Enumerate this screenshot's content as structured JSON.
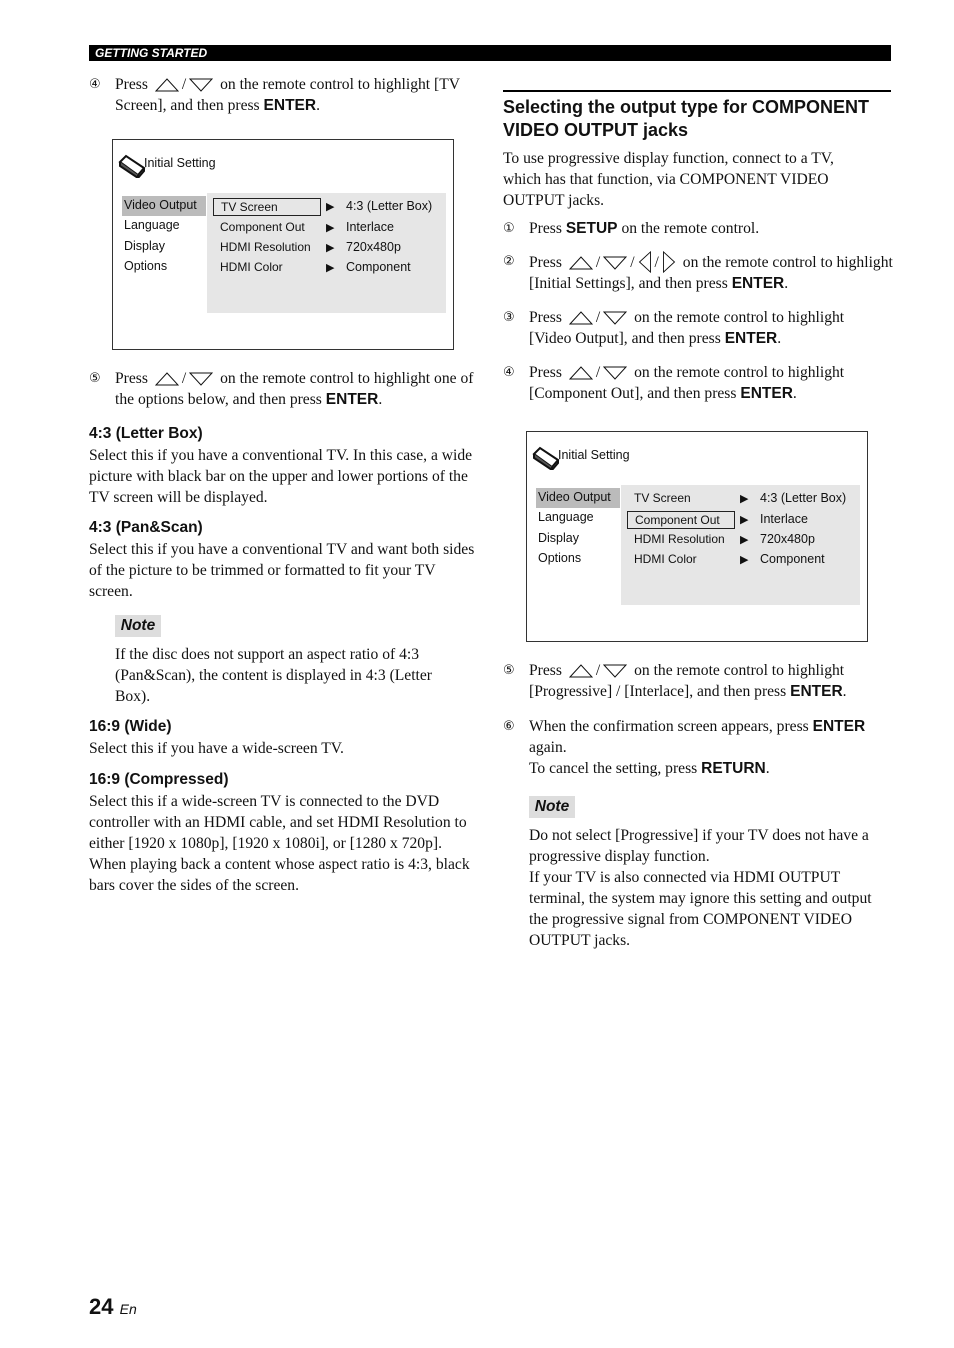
{
  "header": {
    "section": "GETTING STARTED"
  },
  "left": {
    "step4": {
      "num": "④",
      "press": "Press",
      "slash": "/",
      "text": "on the remote control to highlight [TV Screen], and then press",
      "key": "ENTER",
      "end": "."
    },
    "step5": {
      "num": "⑤",
      "press": "Press",
      "slash": "/",
      "text": "on the remote control to highlight one of the options below, and then press",
      "key": "ENTER",
      "end": "."
    },
    "options": [
      {
        "heading": "4:3 (Letter Box)",
        "text": "Select this if you have a conventional TV. In this case, a wide picture with black bar on the upper and lower portions of the TV screen will be displayed."
      },
      {
        "heading": "4:3 (Pan&Scan)",
        "text": "Select this if you have a conventional TV and want both sides of the picture to be trimmed or formatted to fit your TV screen."
      },
      {
        "heading": "16:9 (Wide)",
        "text": "Select this if you have a wide-screen TV."
      },
      {
        "heading": "16:9 (Compressed)",
        "text": "Select this if a wide-screen TV is connected to the DVD controller with an HDMI cable, and set HDMI Resolution to either [1920 x 1080p], [1920 x 1080i], or [1280 x 720p]. When playing back a content whose aspect ratio is 4:3, black bars cover the sides of the screen."
      }
    ],
    "note": {
      "label": "Note",
      "text": "If the disc does not support an aspect ratio of 4:3 (Pan&Scan), the content is displayed in 4:3 (Letter Box)."
    }
  },
  "screen1": {
    "title": "Initial Setting",
    "menu": [
      "Video Output",
      "Language",
      "Display",
      "Options"
    ],
    "rows": [
      {
        "k": "TV Screen",
        "v": "4:3 (Letter Box)"
      },
      {
        "k": "Component Out",
        "v": "Interlace"
      },
      {
        "k": "HDMI Resolution",
        "v": "720x480p"
      },
      {
        "k": "HDMI Color",
        "v": "Component"
      }
    ],
    "arrow": "▶",
    "selected": "TV Screen"
  },
  "screen2": {
    "title": "Initial Setting",
    "menu": [
      "Video Output",
      "Language",
      "Display",
      "Options"
    ],
    "rows": [
      {
        "k": "TV Screen",
        "v": "4:3 (Letter Box)"
      },
      {
        "k": "Component Out",
        "v": "Interlace"
      },
      {
        "k": "HDMI Resolution",
        "v": "720x480p"
      },
      {
        "k": "HDMI Color",
        "v": "Component"
      }
    ],
    "arrow": "▶",
    "selected": "Component Out"
  },
  "right": {
    "heading": "Selecting the output type for COMPONENT VIDEO OUTPUT jacks",
    "intro": "To use progressive display function, connect to a TV, which has that function, via COMPONENT VIDEO OUTPUT jacks.",
    "step1": {
      "num": "①",
      "press": "Press",
      "key": "SETUP",
      "text": "on the remote control."
    },
    "step2": {
      "num": "②",
      "press": "Press",
      "slash": "/",
      "text": "on the remote control to highlight [Initial Settings], and then press",
      "key": "ENTER",
      "end": "."
    },
    "step3": {
      "num": "③",
      "press": "Press",
      "slash": "/",
      "text": "on the remote control to highlight [Video Output], and then press",
      "key": "ENTER",
      "end": "."
    },
    "step4": {
      "num": "④",
      "press": "Press",
      "slash": "/",
      "text": "on the remote control to highlight [Component Out], and then press",
      "key": "ENTER",
      "end": "."
    },
    "step5": {
      "num": "⑤",
      "press": "Press",
      "slash": "/",
      "text": "on the remote control to highlight [Progressive] / [Interlace], and then press",
      "key": "ENTER",
      "end": "."
    },
    "step6": {
      "num": "⑥",
      "text": "When the confirmation screen appears, press",
      "key": "ENTER",
      "text2": "again.",
      "cancel": "To cancel the setting, press",
      "key2": "RETURN",
      "end": "."
    },
    "note": {
      "label": "Note",
      "text1": "Do not select [Progressive] if your TV does not have a progressive display function.",
      "text2": "If your TV is also connected via HDMI OUTPUT terminal, the system may ignore this setting and output the progressive signal from COMPONENT VIDEO OUTPUT jacks."
    }
  },
  "footer": {
    "page": "24",
    "lang": "En"
  }
}
